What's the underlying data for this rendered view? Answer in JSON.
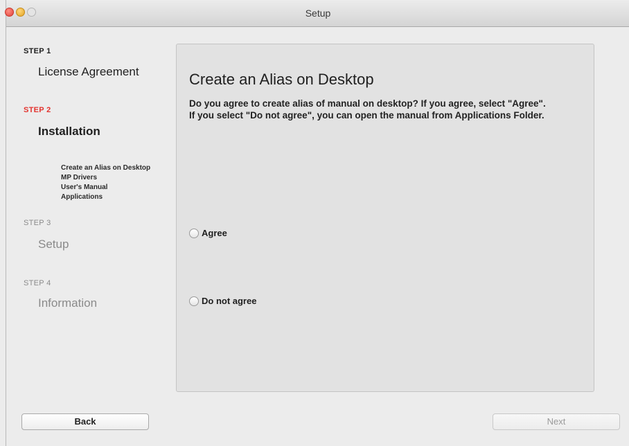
{
  "window": {
    "title": "Setup"
  },
  "steps": [
    {
      "label": "STEP 1",
      "title": "License Agreement",
      "state": "done"
    },
    {
      "label": "STEP 2",
      "title": "Installation",
      "state": "current",
      "substeps": [
        "Create an Alias on Desktop",
        "MP Drivers",
        "User's Manual",
        "Applications"
      ]
    },
    {
      "label": "STEP 3",
      "title": "Setup",
      "state": "pending"
    },
    {
      "label": "STEP 4",
      "title": "Information",
      "state": "pending"
    }
  ],
  "panel": {
    "title": "Create an Alias on Desktop",
    "description": "Do you agree to create alias of manual on desktop? If you agree, select \"Agree\". If you select \"Do not agree\", you can open the manual from Applications Folder.",
    "options": [
      "Agree",
      "Do not agree"
    ],
    "selected": null
  },
  "buttons": {
    "back": "Back",
    "next": "Next",
    "next_enabled": false
  },
  "colors": {
    "current_step": "#e3342f",
    "pending_step": "#8a8a8a"
  }
}
